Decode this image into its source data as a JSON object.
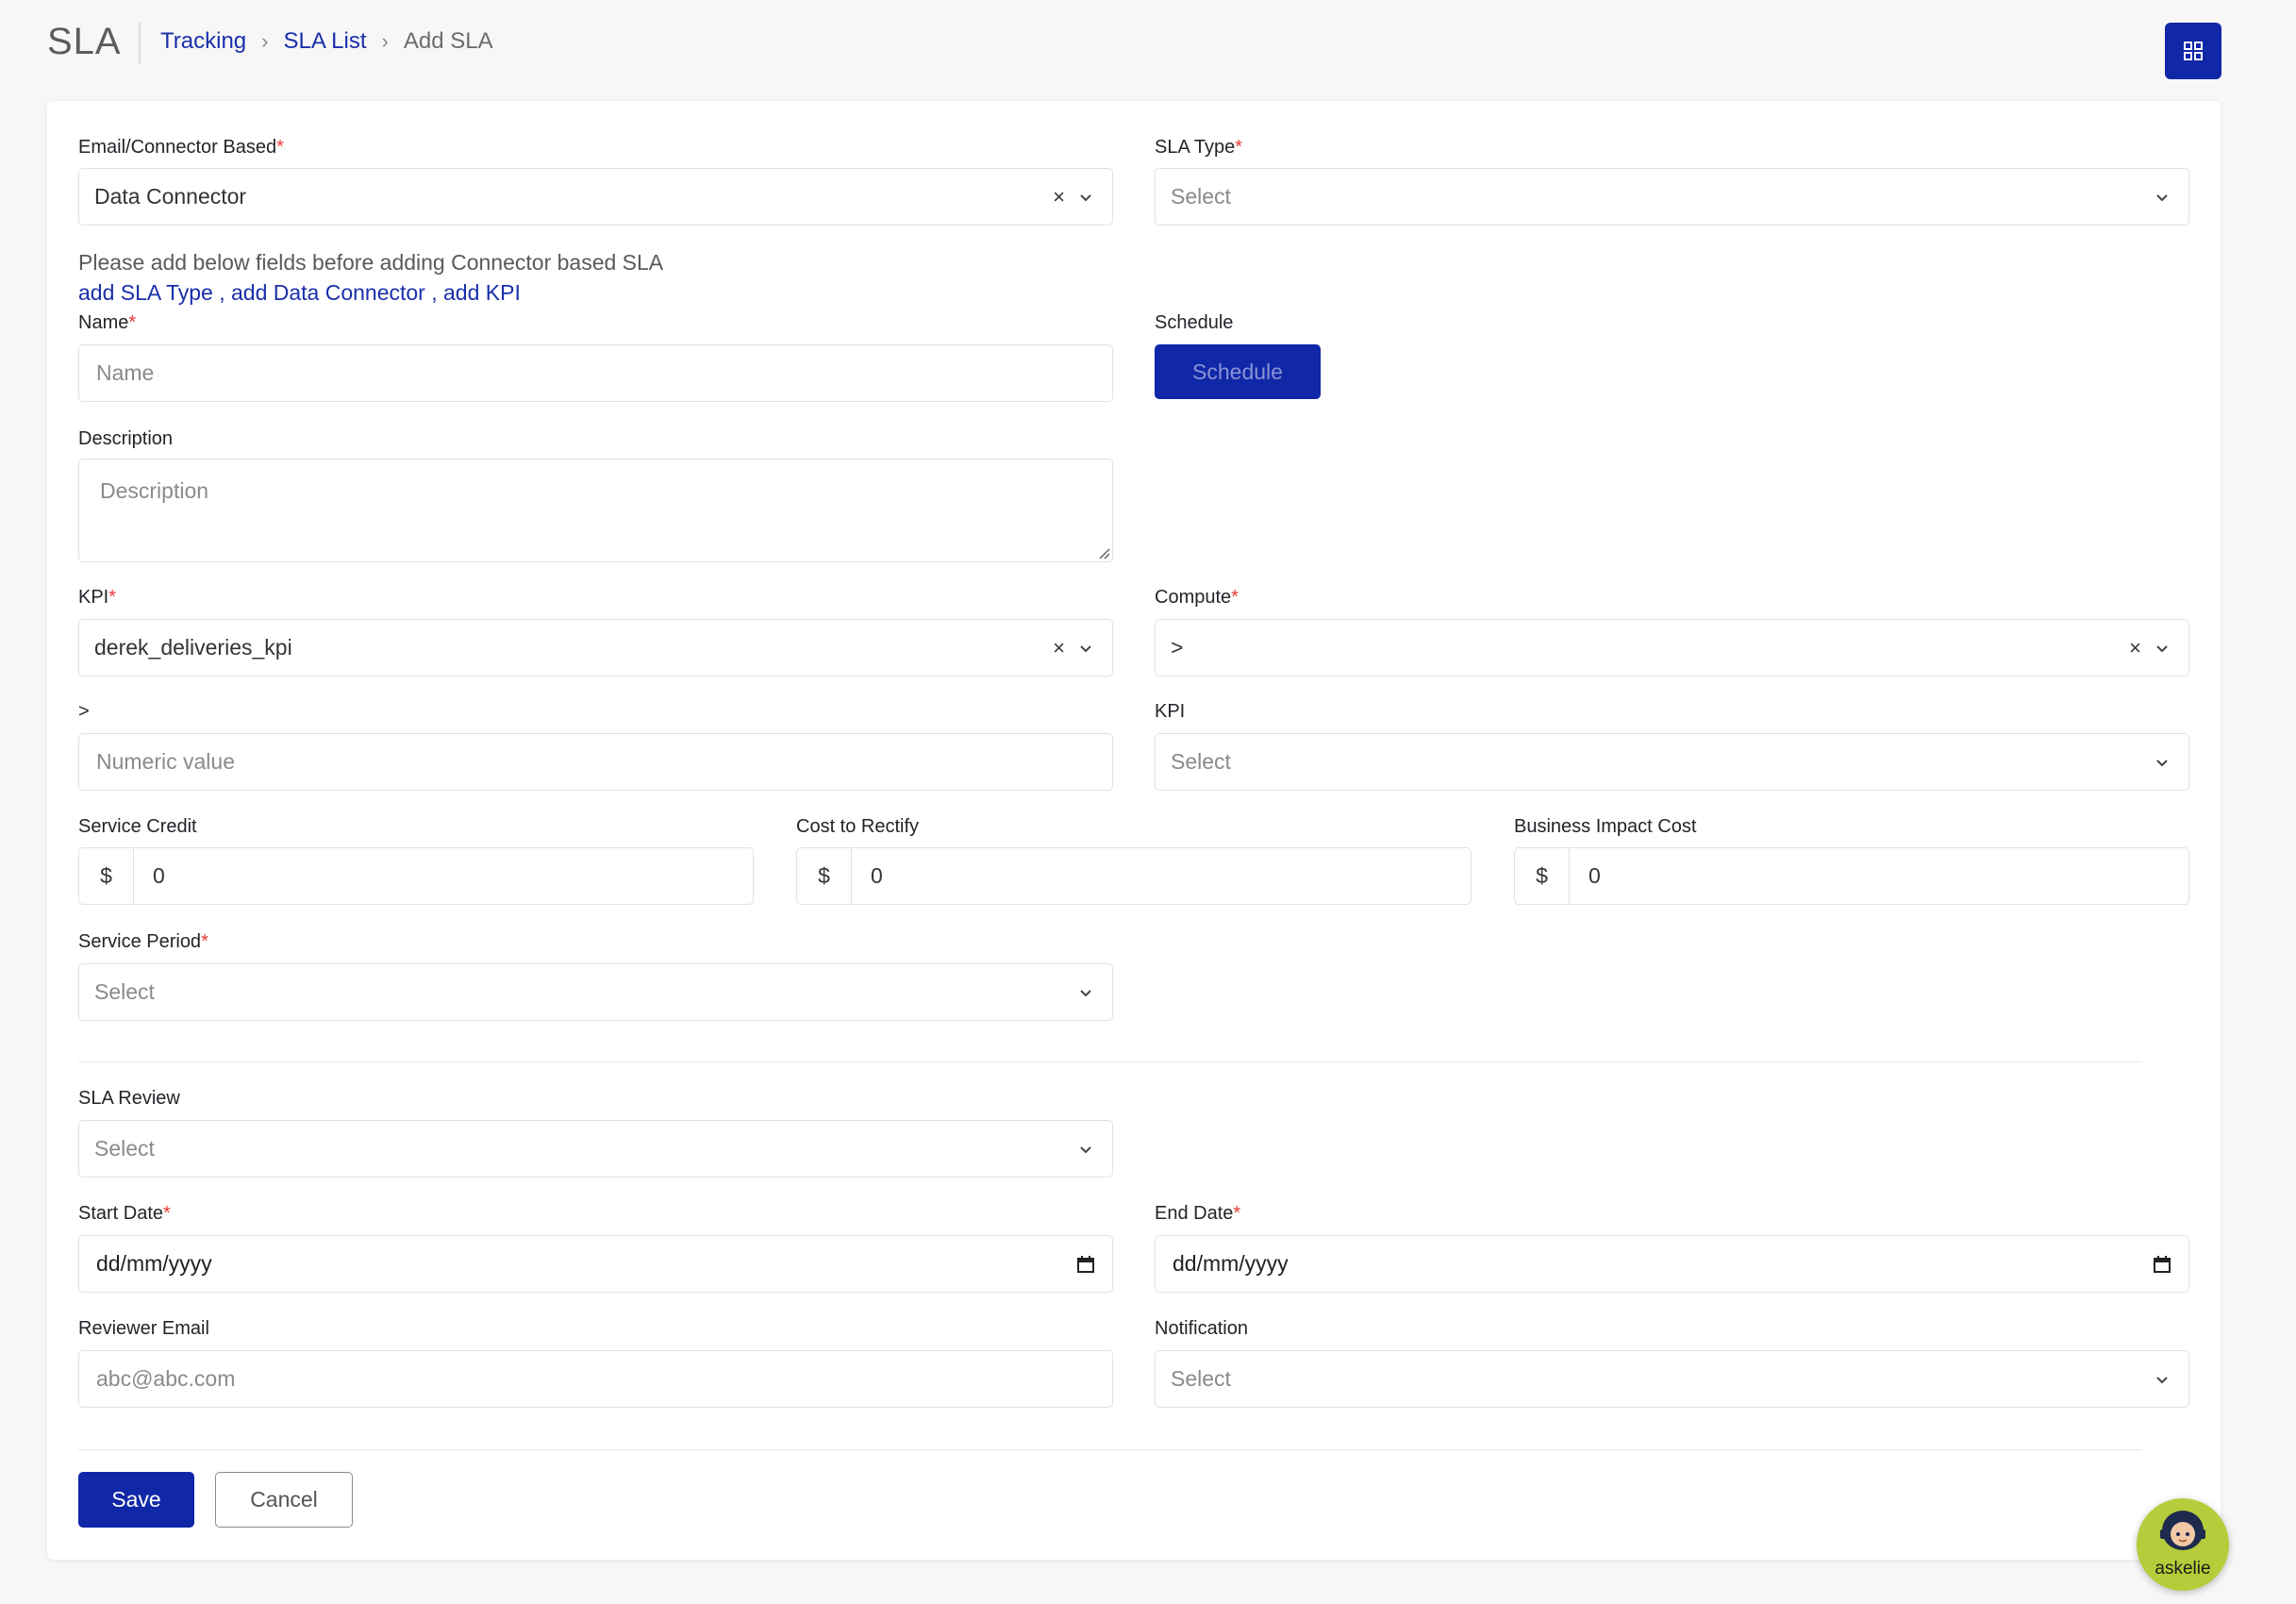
{
  "header": {
    "app_title": "SLA",
    "breadcrumb": [
      "Tracking",
      "SLA List",
      "Add SLA"
    ]
  },
  "form": {
    "email_connector": {
      "label": "Email/Connector Based",
      "value": "Data Connector"
    },
    "sla_type": {
      "label": "SLA Type",
      "placeholder": "Select"
    },
    "note": "Please add below fields before adding Connector based SLA",
    "links": [
      "add SLA Type",
      "add Data Connector",
      "add KPI"
    ],
    "name": {
      "label": "Name",
      "placeholder": "Name"
    },
    "schedule": {
      "label": "Schedule",
      "button": "Schedule"
    },
    "description": {
      "label": "Description",
      "placeholder": "Description"
    },
    "kpi": {
      "label": "KPI",
      "value": "derek_deliveries_kpi"
    },
    "compute": {
      "label": "Compute",
      "value": ">"
    },
    "threshold": {
      "label": ">",
      "placeholder": "Numeric value"
    },
    "kpi2": {
      "label": "KPI",
      "placeholder": "Select"
    },
    "service_credit": {
      "label": "Service Credit",
      "prefix": "$",
      "value": "0"
    },
    "cost_to_rectify": {
      "label": "Cost to Rectify",
      "prefix": "$",
      "value": "0"
    },
    "business_impact": {
      "label": "Business Impact Cost",
      "prefix": "$",
      "value": "0"
    },
    "service_period": {
      "label": "Service Period",
      "placeholder": "Select"
    },
    "sla_review": {
      "label": "SLA Review",
      "placeholder": "Select"
    },
    "start_date": {
      "label": "Start Date",
      "value": "dd/mm/yyyy"
    },
    "end_date": {
      "label": "End Date",
      "value": "dd/mm/yyyy"
    },
    "reviewer_email": {
      "label": "Reviewer Email",
      "placeholder": "abc@abc.com"
    },
    "notification": {
      "label": "Notification",
      "placeholder": "Select"
    }
  },
  "actions": {
    "save": "Save",
    "cancel": "Cancel"
  },
  "assistant": {
    "label": "askelie"
  },
  "colors": {
    "primary": "#1027a8",
    "required": "#e53935",
    "assistant": "#b6cc3a"
  }
}
